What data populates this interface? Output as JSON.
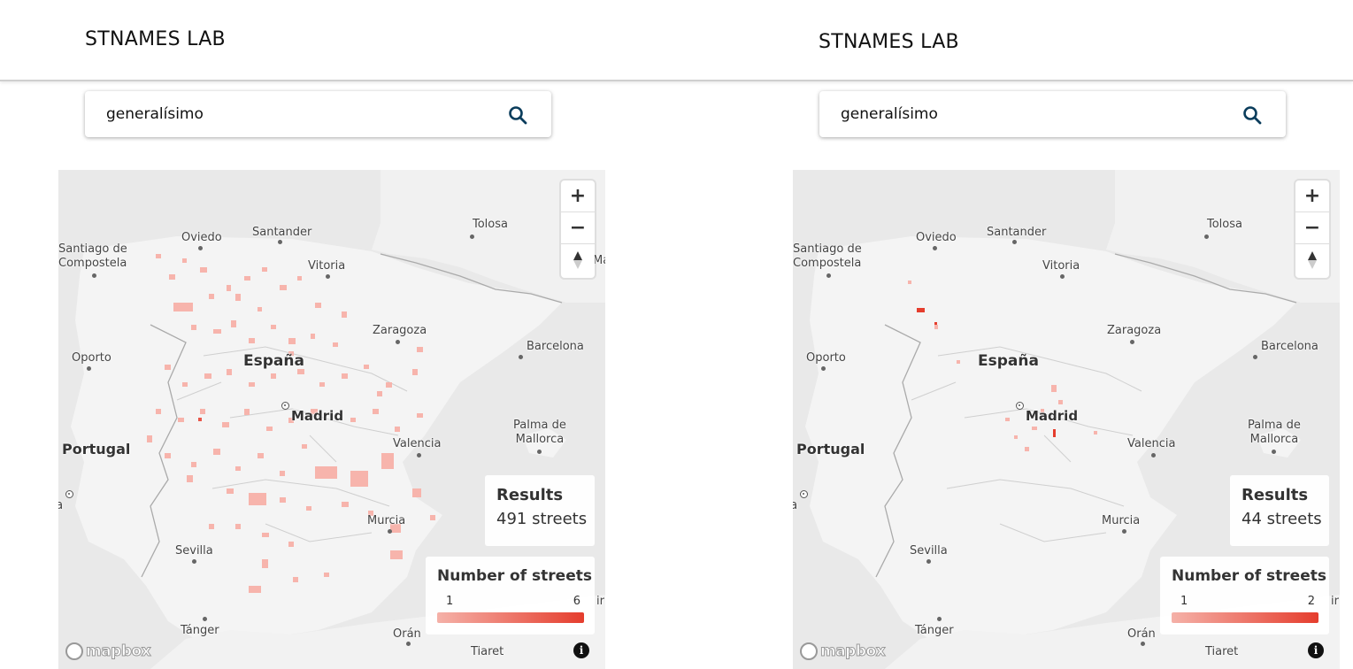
{
  "panels": [
    {
      "brand": "STNAMES LAB",
      "search": {
        "value": "generalísimo",
        "icon": "search-icon"
      },
      "results": {
        "title": "Results",
        "count": "491 streets"
      },
      "legend": {
        "title": "Number of streets",
        "min": "1",
        "max": "6",
        "color_min": "#f5b1a8",
        "color_max": "#e53d2d"
      },
      "cities": {
        "santiago": "Santiago de\nCompostela",
        "oviedo": "Oviedo",
        "santander": "Santander",
        "tolosa": "Tolosa",
        "vitoria": "Vitoria",
        "zaragoza": "Zaragoza",
        "barcelona": "Barcelona",
        "oporto": "Oporto",
        "espana": "España",
        "madrid": "Madrid",
        "palma": "Palma de\nMallorca",
        "portugal": "Portugal",
        "valencia": "Valencia",
        "lisboa": "isboa",
        "murcia": "Murcia",
        "sevilla": "Sevilla",
        "tanger": "Tánger",
        "oran": "Orán",
        "tiaret": "Tiaret",
        "ma": "Ma",
        "ir": "ir"
      },
      "attribution": "mapbox"
    },
    {
      "brand": "STNAMES LAB",
      "search": {
        "value": "generalísimo",
        "icon": "search-icon"
      },
      "results": {
        "title": "Results",
        "count": "44 streets"
      },
      "legend": {
        "title": "Number of streets",
        "min": "1",
        "max": "2",
        "color_min": "#f5b1a8",
        "color_max": "#e53d2d"
      },
      "cities": {
        "santiago": "Santiago de\nCompostela",
        "oviedo": "Oviedo",
        "santander": "Santander",
        "tolosa": "Tolosa",
        "vitoria": "Vitoria",
        "zaragoza": "Zaragoza",
        "barcelona": "Barcelona",
        "oporto": "Oporto",
        "espana": "España",
        "madrid": "Madrid",
        "palma": "Palma de\nMallorca",
        "portugal": "Portugal",
        "valencia": "Valencia",
        "lisboa": "isboa",
        "murcia": "Murcia",
        "sevilla": "Sevilla",
        "tanger": "Tánger",
        "oran": "Orán",
        "tiaret": "Tiaret",
        "ir": "ir"
      },
      "attribution": "mapbox"
    }
  ],
  "controls": {
    "zoom_in": "+",
    "zoom_out": "−",
    "info": "i"
  }
}
